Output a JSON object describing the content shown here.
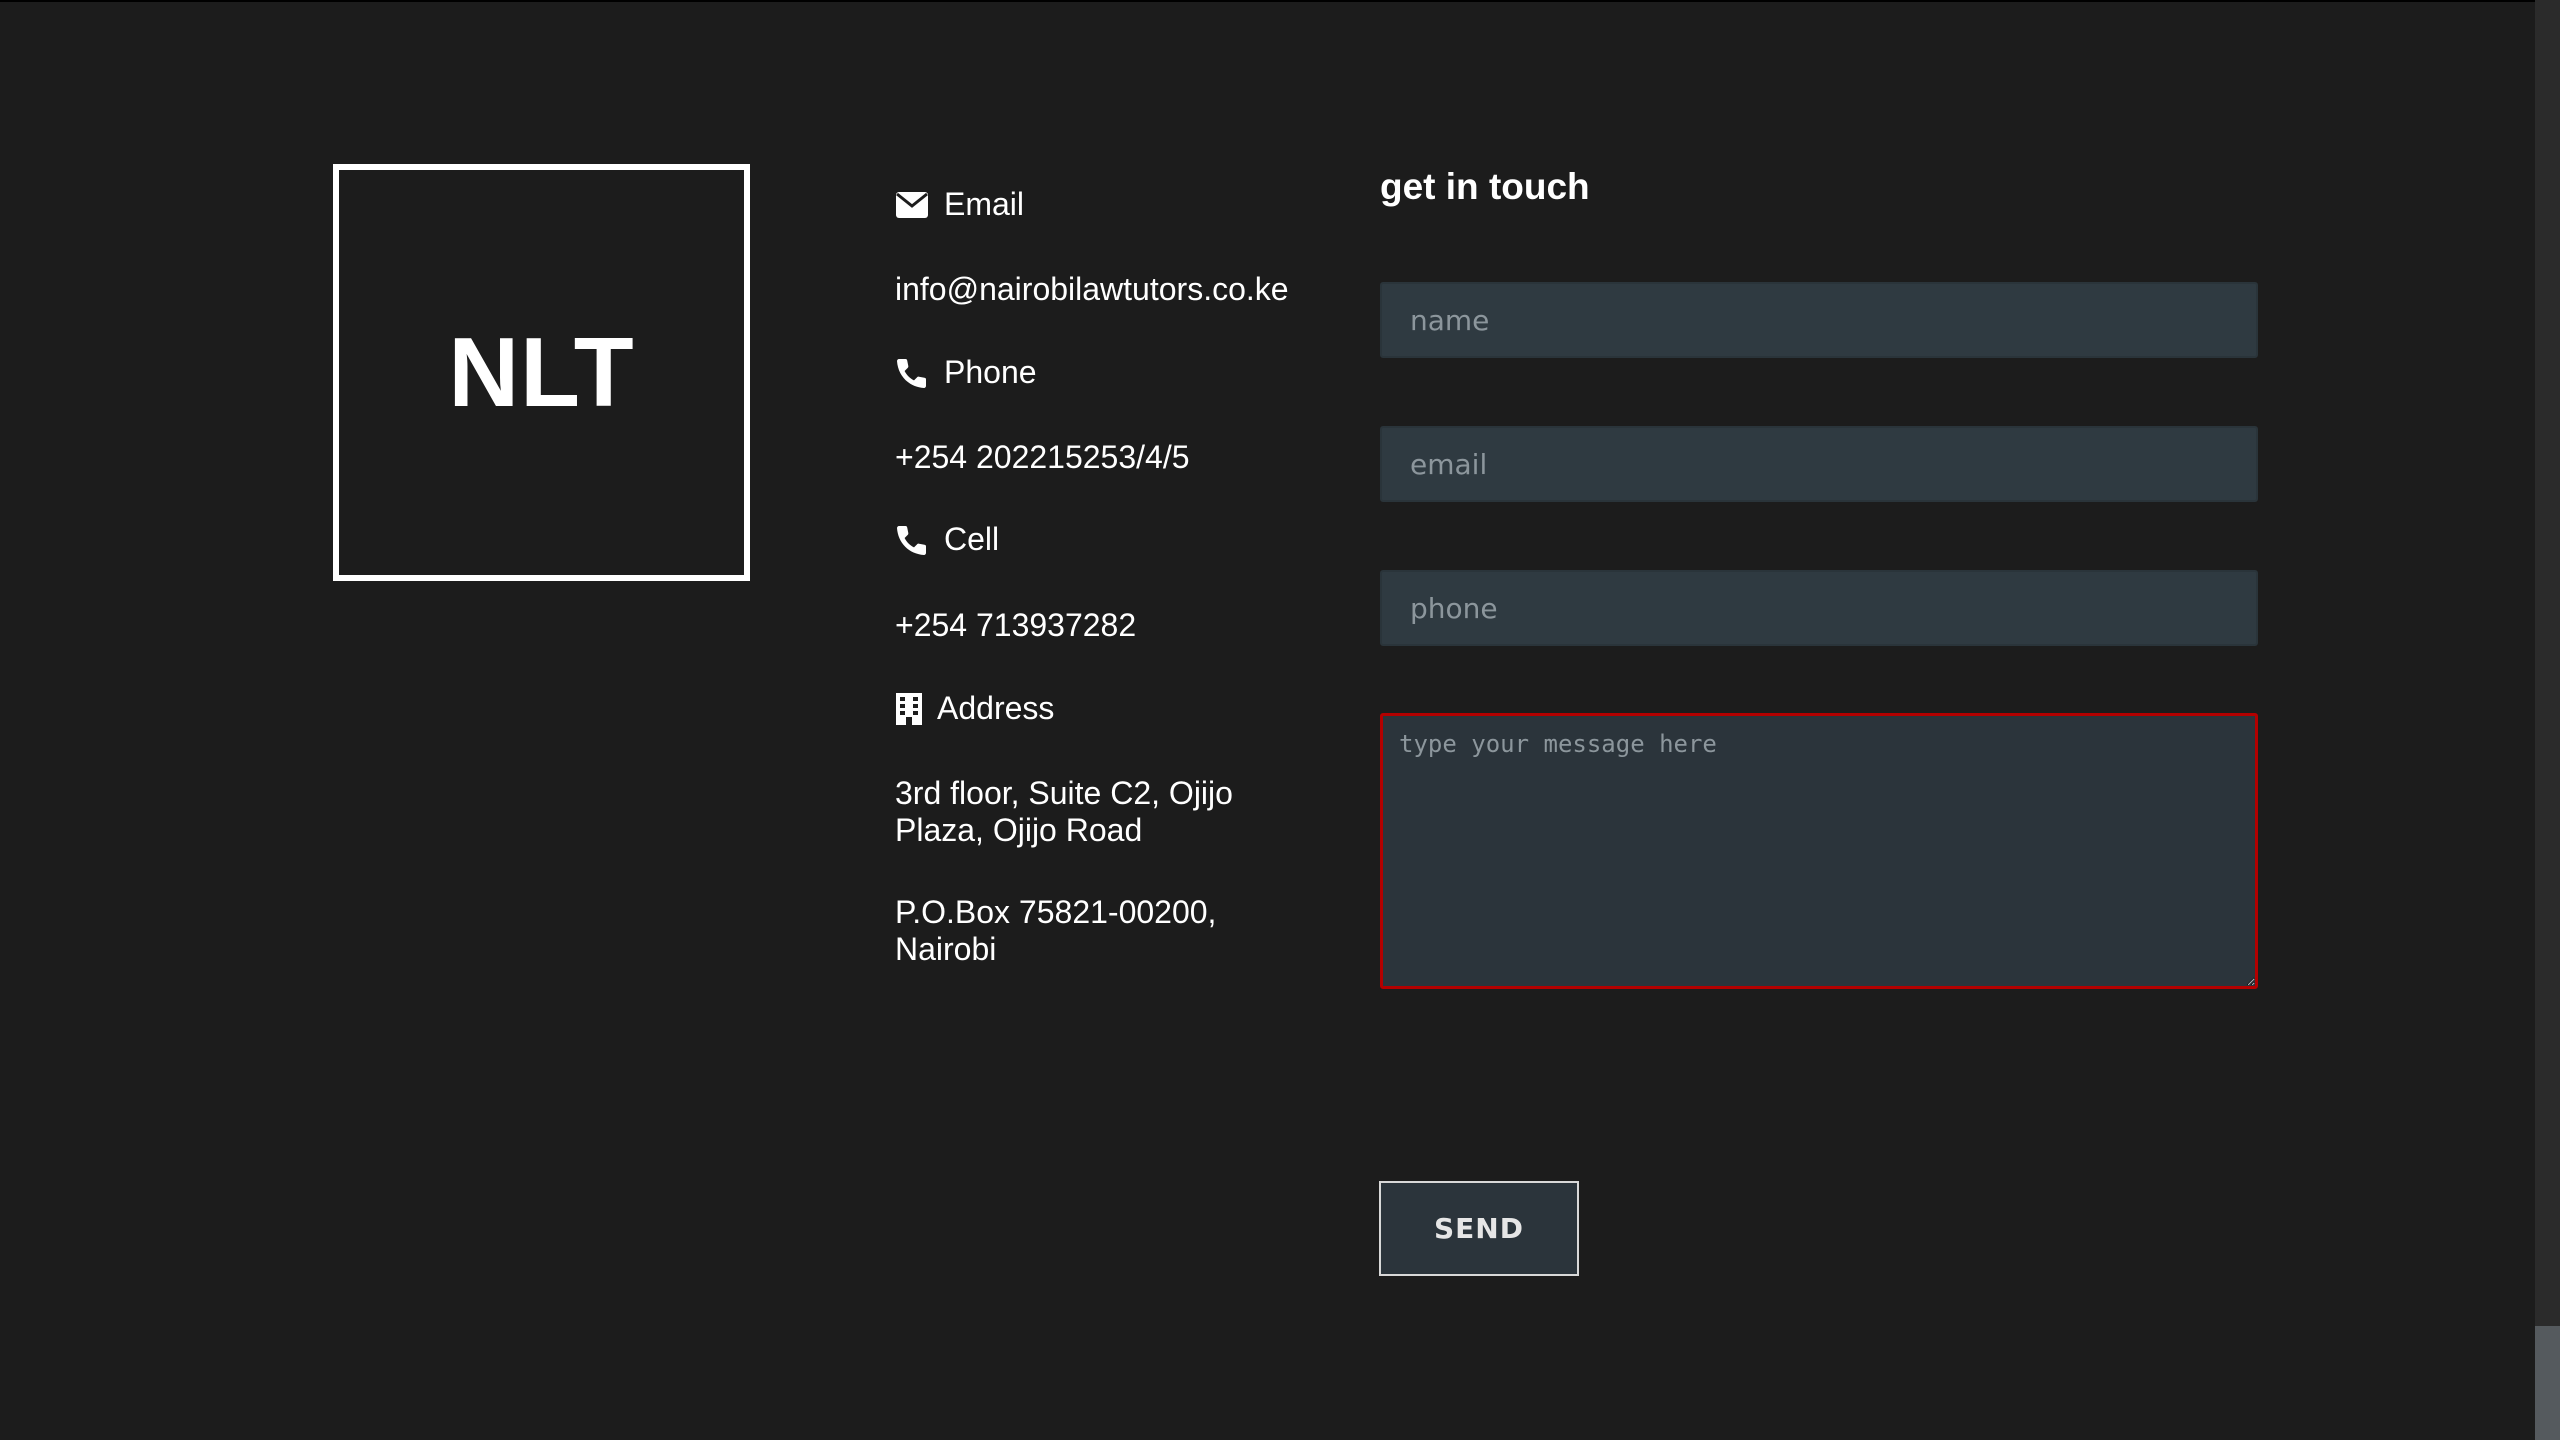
{
  "logo": {
    "text": "NLT"
  },
  "contact": {
    "email": {
      "label": "Email",
      "value": "info@nairobilawtutors.co.ke",
      "icon": "envelope-icon"
    },
    "phone": {
      "label": "Phone",
      "value": "+254 202215253/4/5",
      "icon": "phone-icon"
    },
    "cell": {
      "label": "Cell",
      "value": "+254 713937282",
      "icon": "phone-icon"
    },
    "address": {
      "label": "Address",
      "icon": "building-icon",
      "line1": "3rd floor, Suite C2, Ojijo Plaza, Ojijo Road",
      "line2": "P.O.Box 75821-00200, Nairobi"
    }
  },
  "form": {
    "title": "get in touch",
    "name_placeholder": "name",
    "email_placeholder": "email",
    "phone_placeholder": "phone",
    "message_placeholder": "type your message here",
    "send_label": "SEND"
  },
  "colors": {
    "background": "#1c1c1c",
    "field_background": "#2f3a41",
    "message_border": "#b30000",
    "text": "#ffffff"
  }
}
